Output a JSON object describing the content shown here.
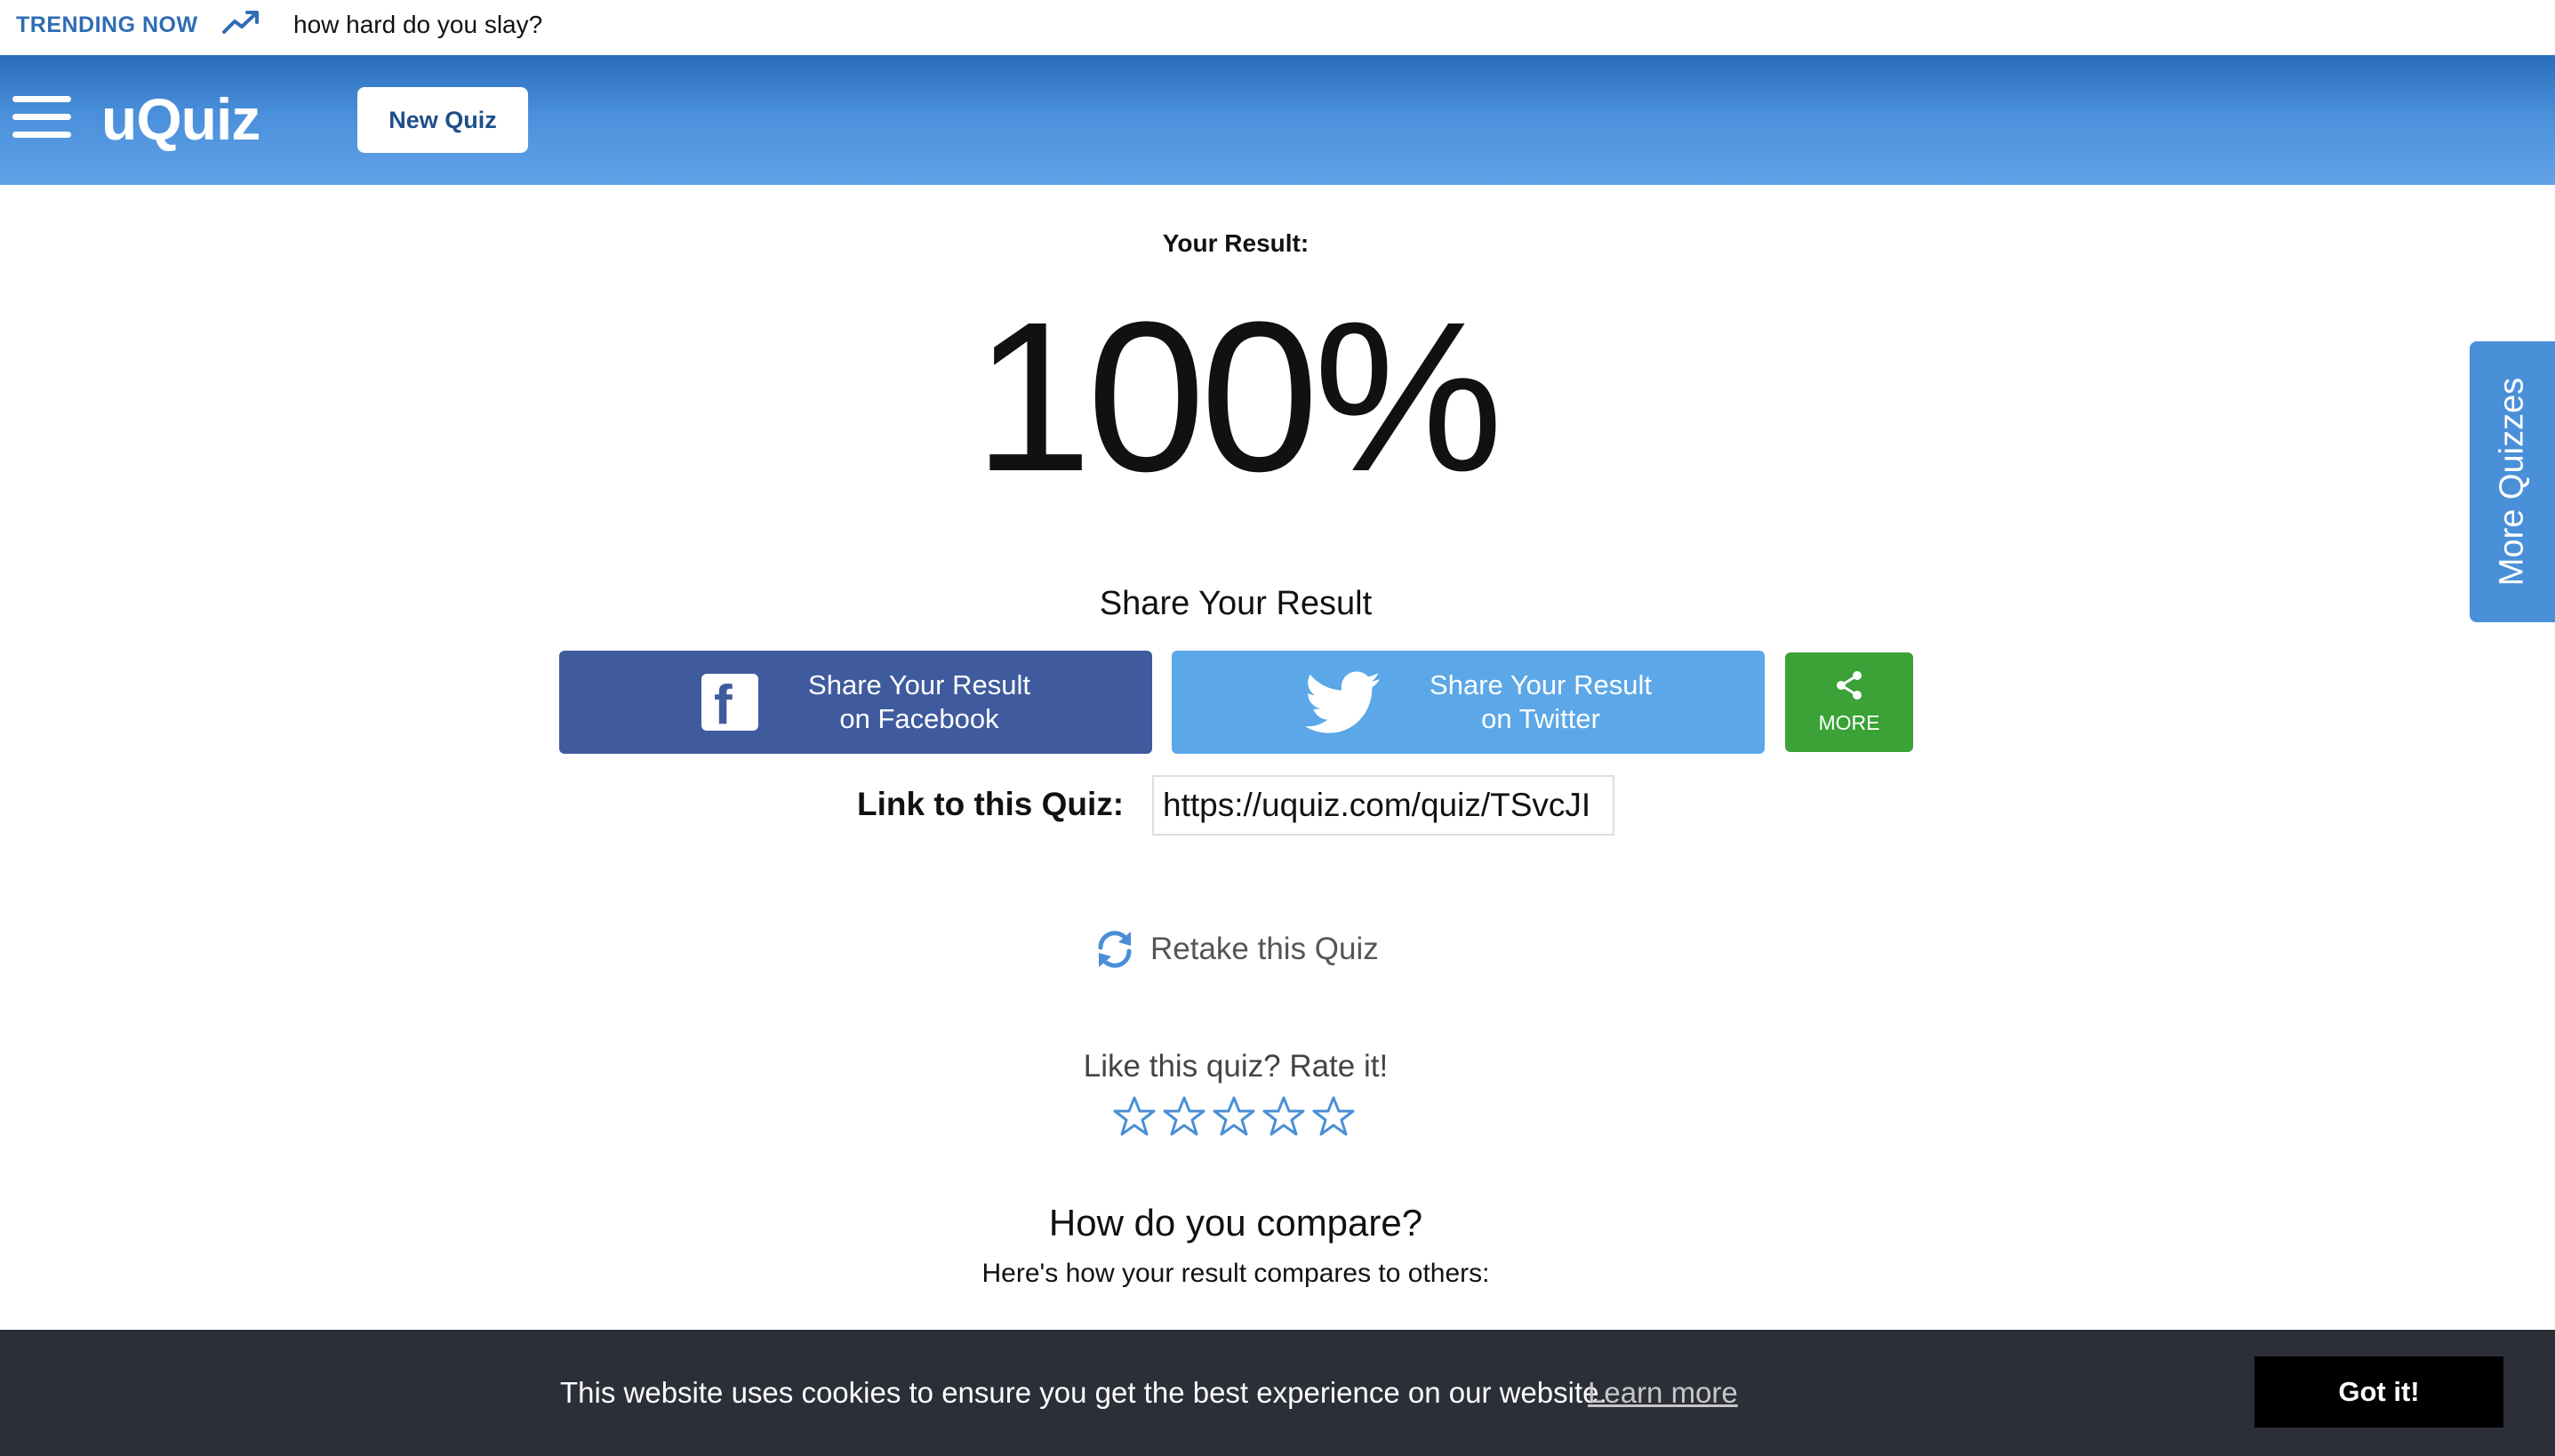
{
  "trending": {
    "label": "TRENDING NOW",
    "icon": "trending-up-icon",
    "link_text": "how hard do you slay?"
  },
  "header": {
    "logo_text": "uQuiz",
    "new_quiz_label": "New Quiz",
    "menu_icon": "hamburger-menu-icon"
  },
  "result": {
    "heading": "Your Result:",
    "score": "100%"
  },
  "share": {
    "heading": "Share Your Result",
    "facebook_line1": "Share Your Result",
    "facebook_line2": "on Facebook",
    "twitter_line1": "Share Your Result",
    "twitter_line2": "on Twitter",
    "more_label": "MORE"
  },
  "link": {
    "label": "Link to this Quiz:",
    "value": "https://uquiz.com/quiz/TSvcJI"
  },
  "retake": {
    "label": "Retake this Quiz"
  },
  "rating": {
    "label": "Like this quiz? Rate it!",
    "max_stars": 5,
    "current": 0
  },
  "compare": {
    "title": "How do you compare?",
    "subtitle": "Here's how your result compares to others:"
  },
  "side_tab": {
    "label": "More Quizzes"
  },
  "cookie": {
    "message": "This website uses cookies to ensure you get the best experience on our website.",
    "learn_more": "Learn more",
    "accept": "Got it!"
  },
  "colors": {
    "header_top": "#2a6dbb",
    "header_bottom": "#62a3e8",
    "facebook": "#3f5b9e",
    "twitter": "#5ba7e7",
    "more": "#3aa236",
    "side_tab": "#4a90d9",
    "cookie_bar": "#2c2f38"
  }
}
